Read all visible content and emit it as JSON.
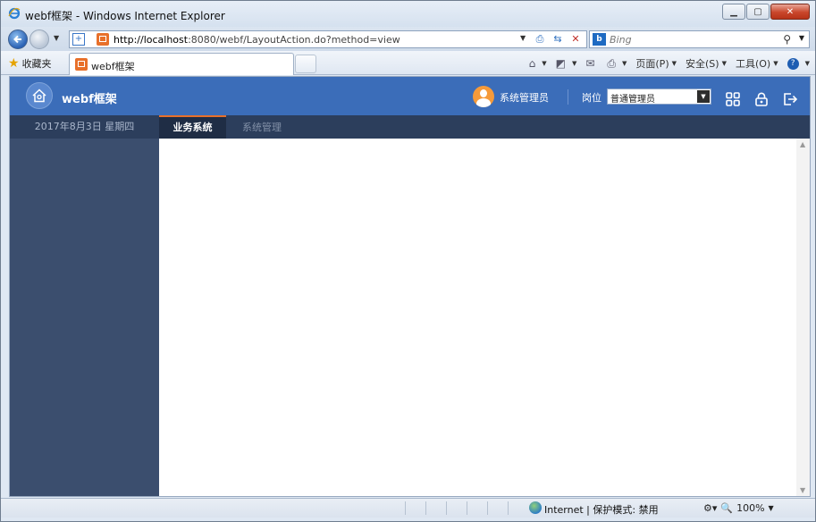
{
  "browser": {
    "window_title": "webf框架 - Windows Internet Explorer",
    "url_host": "http://localhost",
    "url_rest": ":8080/webf/LayoutAction.do?method=view",
    "search_placeholder": "Bing",
    "favorites_label": "收藏夹",
    "tab_title": "webf框架",
    "commands": {
      "page": "页面(P)",
      "safety": "安全(S)",
      "tools": "工具(O)"
    },
    "status": {
      "zone": "Internet | 保护模式: 禁用",
      "zoom": "100%"
    }
  },
  "app": {
    "title": "webf框架",
    "user_name": "系统管理员",
    "post_label": "岗位",
    "post_value": "普通管理员",
    "date": "2017年8月3日 星期四",
    "tabs": [
      {
        "label": "业务系统",
        "active": true
      },
      {
        "label": "系统管理",
        "active": false
      }
    ],
    "colors": {
      "header": "#3b6db9",
      "nav": "#2c3e5c",
      "sidebar": "#3b4e6e",
      "accent": "#e8702a"
    }
  }
}
